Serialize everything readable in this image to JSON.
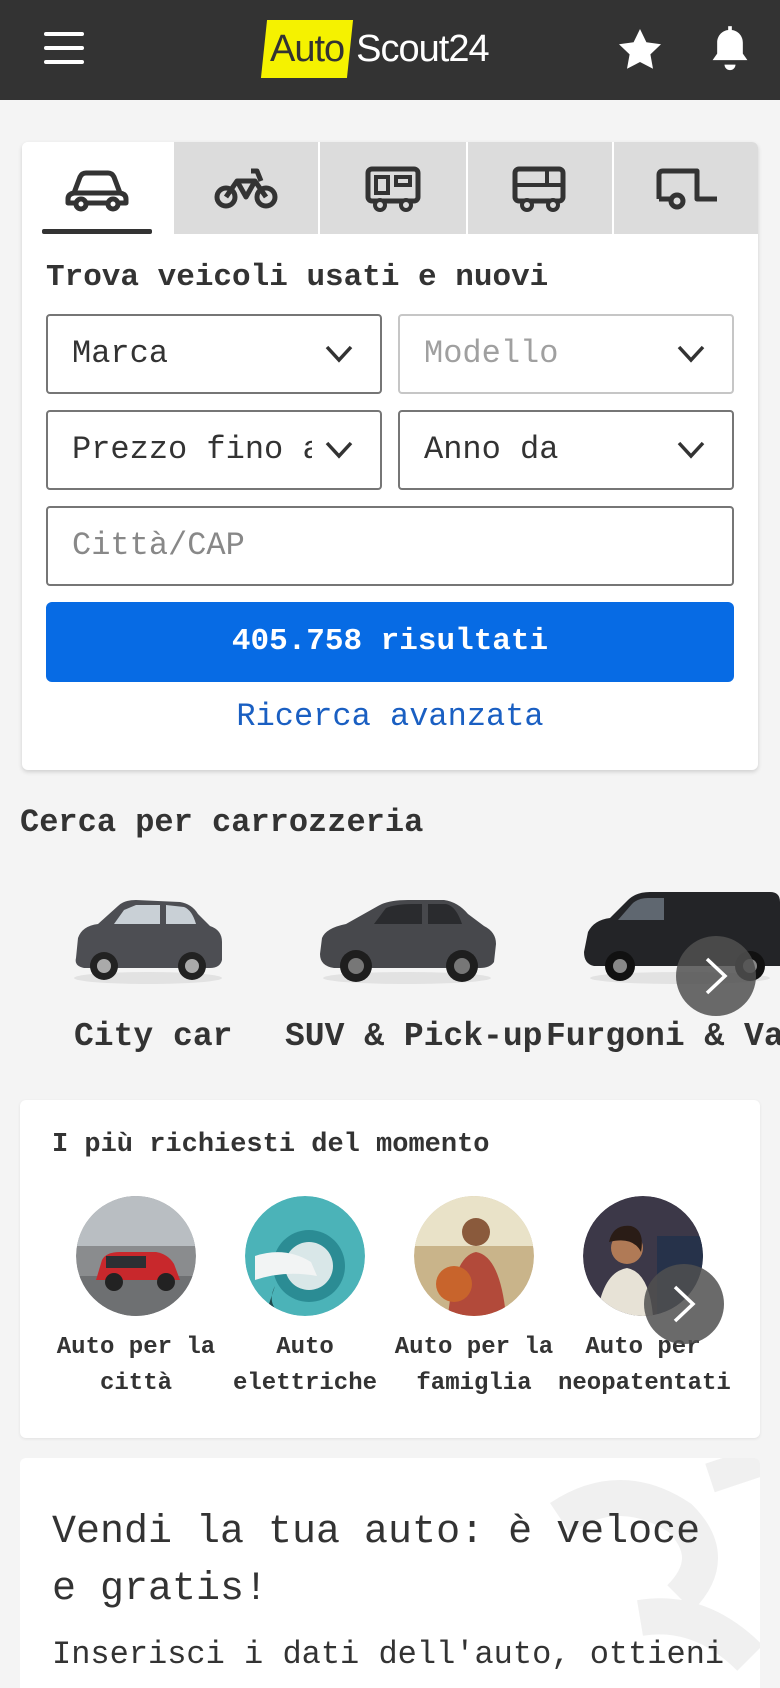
{
  "header": {
    "logo_auto": "Auto",
    "logo_scout": "Scout24",
    "brand_yellow": "#f5f200",
    "icons": [
      "hamburger-menu-icon",
      "star-icon",
      "bell-icon"
    ]
  },
  "vehicle_tabs": [
    {
      "name": "car",
      "icon": "car-icon",
      "active": true
    },
    {
      "name": "motorbike",
      "icon": "motorbike-icon",
      "active": false
    },
    {
      "name": "camper",
      "icon": "camper-icon",
      "active": false
    },
    {
      "name": "truck",
      "icon": "truck-icon",
      "active": false
    },
    {
      "name": "trailer",
      "icon": "trailer-icon",
      "active": false
    }
  ],
  "search": {
    "title": "Trova veicoli usati e nuovi",
    "make": "Marca",
    "model": "Modello",
    "price": "Prezzo fino a",
    "year": "Anno da",
    "city_placeholder": "Città/CAP",
    "results_button": "405.758 risultati",
    "advanced_link": "Ricerca avanzata",
    "accent": "#076be4"
  },
  "body_types": {
    "title": "Cerca per carrozzeria",
    "items": [
      "City car",
      "SUV & Pick-up",
      "Furgoni & Van"
    ]
  },
  "popular": {
    "title": "I più richiesti del momento",
    "items": [
      {
        "line1": "Auto per la",
        "line2": "città"
      },
      {
        "line1": "Auto",
        "line2": "elettriche"
      },
      {
        "line1": "Auto per la",
        "line2": "famiglia"
      },
      {
        "line1": "Auto per",
        "line2": "neopatentati"
      }
    ]
  },
  "sell": {
    "title": "Vendi la tua auto: è veloce e gratis!",
    "text": "Inserisci i dati dell'auto, ottieni"
  }
}
